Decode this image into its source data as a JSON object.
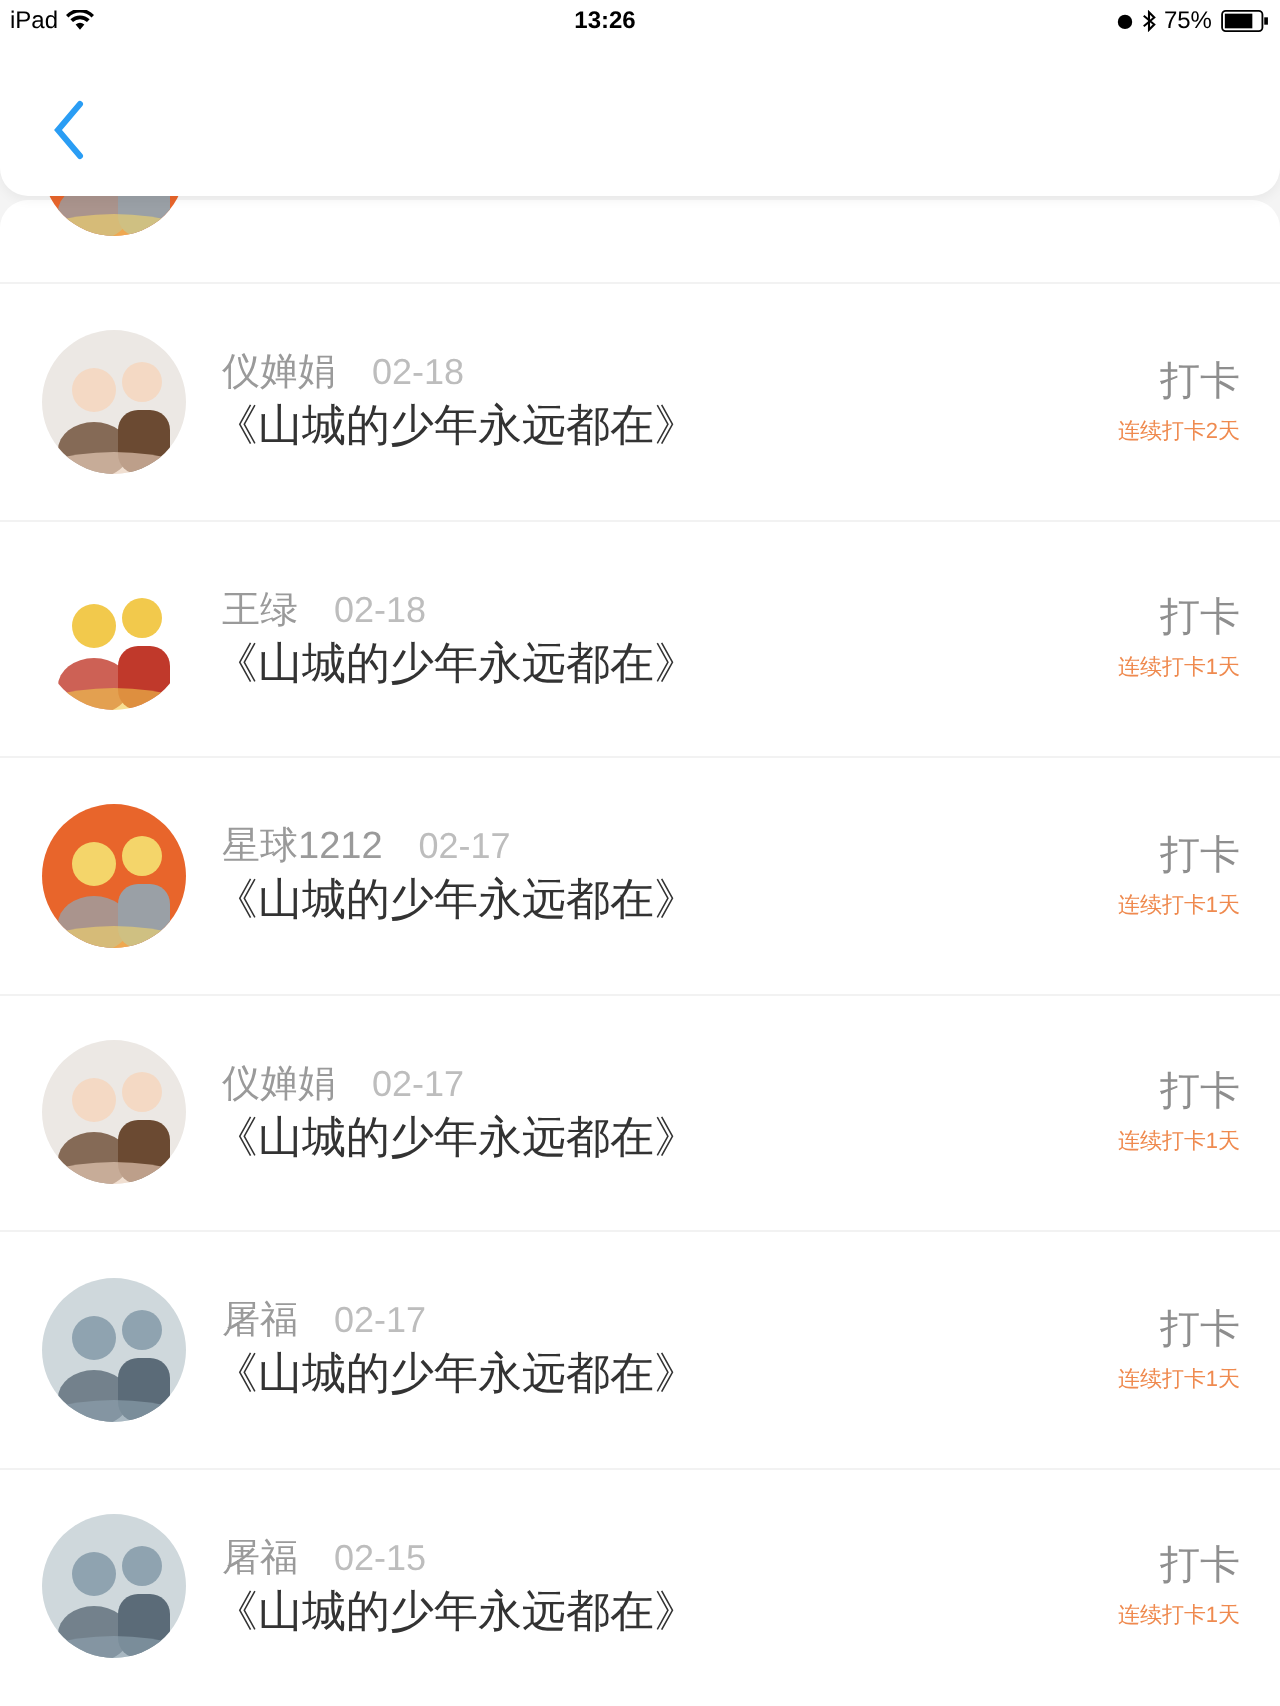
{
  "status_bar": {
    "device": "iPad",
    "time": "13:26",
    "battery": "75%"
  },
  "rows": [
    {
      "name": "仪婵娟",
      "date": "02-18",
      "title": "《山城的少年永远都在》",
      "action": "打卡",
      "streak": "连续打卡2天"
    },
    {
      "name": "王绿",
      "date": "02-18",
      "title": "《山城的少年永远都在》",
      "action": "打卡",
      "streak": "连续打卡1天"
    },
    {
      "name": "星球1212",
      "date": "02-17",
      "title": "《山城的少年永远都在》",
      "action": "打卡",
      "streak": "连续打卡1天"
    },
    {
      "name": "仪婵娟",
      "date": "02-17",
      "title": "《山城的少年永远都在》",
      "action": "打卡",
      "streak": "连续打卡1天"
    },
    {
      "name": "屠福",
      "date": "02-17",
      "title": "《山城的少年永远都在》",
      "action": "打卡",
      "streak": "连续打卡1天"
    },
    {
      "name": "屠福",
      "date": "02-15",
      "title": "《山城的少年永远都在》",
      "action": "打卡",
      "streak": "连续打卡1天"
    }
  ]
}
